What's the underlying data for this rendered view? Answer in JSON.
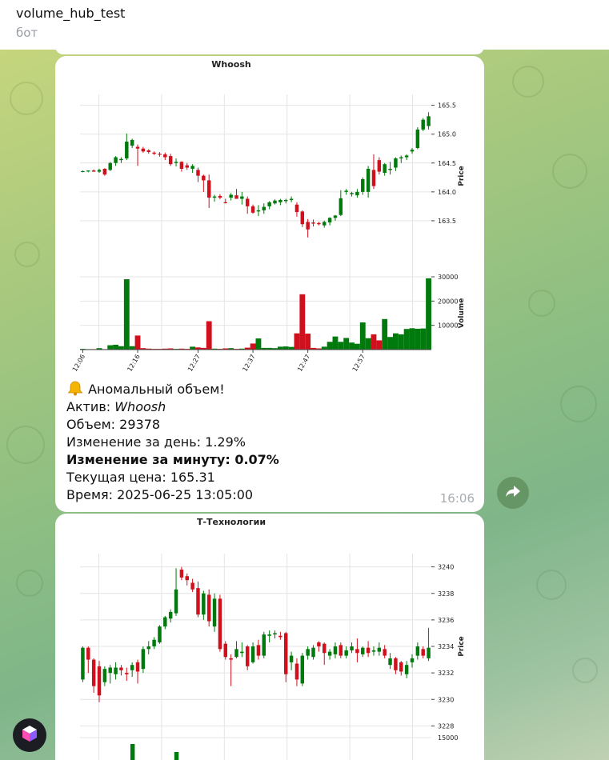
{
  "header": {
    "title": "volume_hub_test",
    "subtitle": "бот"
  },
  "message1": {
    "bell_icon": "bell-icon",
    "alert_text": "Аномальный объем!",
    "asset_label": "Актив: ",
    "asset_value": "Whoosh",
    "volume_line": "Объем: 29378",
    "day_change_line": "Изменение за день: 1.29%",
    "minute_change_line": "Изменение за минуту: 0.07%",
    "price_line": "Текущая цена: 165.31",
    "time_line": "Время: 2025-06-25 13:05:00",
    "timestamp": "16:06"
  },
  "message2": {},
  "colors": {
    "up": "#007a0c",
    "down": "#d0101d",
    "grid": "#e4e4e4"
  },
  "chart_data": [
    {
      "type": "candlestick",
      "title": "Whoosh",
      "ylabel": "Price",
      "volume_label": "Volume",
      "x_ticks": [
        "12:06",
        "12:16",
        "12:27",
        "12:37",
        "12:47",
        "12:57"
      ],
      "x_tick_index": [
        0,
        10,
        21,
        31,
        41,
        51
      ],
      "price_ticks": [
        "163.5",
        "164.0",
        "164.5",
        "165.0",
        "165.5"
      ],
      "volume_ticks": [
        "10000",
        "20000",
        "30000"
      ],
      "ylim": [
        163.0,
        165.55
      ],
      "vlim": [
        0,
        30000
      ],
      "candles": [
        [
          164.36,
          164.37,
          164.34,
          164.36,
          300
        ],
        [
          164.36,
          164.37,
          164.34,
          164.37,
          200
        ],
        [
          164.37,
          164.39,
          164.35,
          164.35,
          200
        ],
        [
          164.35,
          164.4,
          164.33,
          164.38,
          600
        ],
        [
          164.4,
          164.41,
          164.28,
          164.3,
          200
        ],
        [
          164.38,
          164.52,
          164.36,
          164.5,
          1800
        ],
        [
          164.5,
          164.62,
          164.45,
          164.6,
          2000
        ],
        [
          164.55,
          164.6,
          164.5,
          164.57,
          1400
        ],
        [
          164.58,
          165.01,
          164.55,
          164.87,
          29000
        ],
        [
          164.8,
          164.92,
          164.76,
          164.9,
          1400
        ],
        [
          164.78,
          164.82,
          164.45,
          164.75,
          5800
        ],
        [
          164.75,
          164.78,
          164.68,
          164.7,
          600
        ],
        [
          164.72,
          164.74,
          164.66,
          164.69,
          400
        ],
        [
          164.68,
          164.7,
          164.64,
          164.66,
          300
        ],
        [
          164.66,
          164.69,
          164.61,
          164.65,
          300
        ],
        [
          164.65,
          164.68,
          164.55,
          164.6,
          400
        ],
        [
          164.62,
          164.66,
          164.45,
          164.48,
          500
        ],
        [
          164.5,
          164.58,
          164.44,
          164.52,
          300
        ],
        [
          164.52,
          164.53,
          164.35,
          164.4,
          400
        ],
        [
          164.46,
          164.5,
          164.38,
          164.42,
          300
        ],
        [
          164.4,
          164.48,
          164.33,
          164.45,
          1200
        ],
        [
          164.38,
          164.42,
          164.17,
          164.28,
          900
        ],
        [
          164.28,
          164.3,
          164.0,
          164.2,
          700
        ],
        [
          164.2,
          164.3,
          163.72,
          163.9,
          11700
        ],
        [
          163.9,
          163.95,
          163.83,
          163.92,
          400
        ],
        [
          163.93,
          163.96,
          163.87,
          163.9,
          300
        ],
        [
          163.82,
          163.88,
          163.8,
          163.81,
          500
        ],
        [
          163.9,
          163.98,
          163.85,
          163.95,
          600
        ],
        [
          163.94,
          164.05,
          163.9,
          163.88,
          300
        ],
        [
          163.88,
          164.0,
          163.78,
          163.92,
          400
        ],
        [
          163.88,
          163.92,
          163.62,
          163.75,
          800
        ],
        [
          163.75,
          163.78,
          163.62,
          163.64,
          2500
        ],
        [
          163.66,
          163.77,
          163.58,
          163.68,
          4600
        ],
        [
          163.68,
          163.8,
          163.62,
          163.74,
          700
        ],
        [
          163.75,
          163.84,
          163.7,
          163.82,
          700
        ],
        [
          163.8,
          163.87,
          163.78,
          163.85,
          600
        ],
        [
          163.82,
          163.88,
          163.77,
          163.86,
          1200
        ],
        [
          163.84,
          163.88,
          163.8,
          163.86,
          1300
        ],
        [
          163.86,
          163.92,
          163.82,
          163.88,
          1100
        ],
        [
          163.78,
          163.82,
          163.57,
          163.65,
          6700
        ],
        [
          163.66,
          163.68,
          163.39,
          163.44,
          22800
        ],
        [
          163.48,
          163.53,
          163.21,
          163.35,
          6600
        ],
        [
          163.47,
          163.52,
          163.4,
          163.45,
          700
        ],
        [
          163.46,
          163.48,
          163.42,
          163.44,
          500
        ],
        [
          163.42,
          163.5,
          163.38,
          163.48,
          1200
        ],
        [
          163.47,
          163.56,
          163.42,
          163.55,
          3200
        ],
        [
          163.55,
          163.6,
          163.5,
          163.59,
          5400
        ],
        [
          163.6,
          164.03,
          163.58,
          163.89,
          3200
        ],
        [
          164.0,
          164.05,
          163.95,
          164.02,
          4800
        ],
        [
          163.96,
          164.0,
          163.92,
          163.98,
          2900
        ],
        [
          163.94,
          164.05,
          163.9,
          164.0,
          2400
        ],
        [
          164.0,
          164.25,
          163.95,
          164.22,
          11200
        ],
        [
          164.0,
          164.45,
          163.9,
          164.4,
          4700
        ],
        [
          164.38,
          164.65,
          164.05,
          164.1,
          6300
        ],
        [
          164.55,
          164.6,
          164.3,
          164.35,
          3800
        ],
        [
          164.33,
          164.5,
          164.28,
          164.48,
          12600
        ],
        [
          164.38,
          164.52,
          164.3,
          164.4,
          5200
        ],
        [
          164.42,
          164.6,
          164.36,
          164.58,
          6700
        ],
        [
          164.58,
          164.63,
          164.5,
          164.6,
          6300
        ],
        [
          164.6,
          164.65,
          164.55,
          164.63,
          8500
        ],
        [
          164.7,
          164.76,
          164.66,
          164.73,
          8800
        ],
        [
          164.76,
          165.12,
          164.74,
          165.08,
          8600
        ],
        [
          165.08,
          165.28,
          165.05,
          165.25,
          8700
        ],
        [
          165.14,
          165.38,
          165.08,
          165.31,
          29378
        ]
      ]
    },
    {
      "type": "candlestick",
      "title": "Т-Технологии",
      "ylabel": "Price",
      "price_ticks": [
        "3228",
        "3230",
        "3232",
        "3234",
        "3236",
        "3238",
        "3240"
      ],
      "volume_ticks": [
        "15000"
      ],
      "ylim": [
        3227.6,
        3240.4
      ],
      "candles": [
        [
          3231.5,
          3234.0,
          3231.3,
          3233.9
        ],
        [
          3233.9,
          3234.0,
          3232.0,
          3233.0
        ],
        [
          3233.0,
          3233.1,
          3230.5,
          3231.0
        ],
        [
          3232.5,
          3232.9,
          3229.8,
          3230.3
        ],
        [
          3231.3,
          3232.5,
          3231.0,
          3232.3
        ],
        [
          3232.0,
          3232.6,
          3231.2,
          3232.4
        ],
        [
          3231.9,
          3232.8,
          3231.5,
          3232.4
        ],
        [
          3232.4,
          3232.6,
          3231.8,
          3232.2
        ],
        [
          3232.0,
          3232.4,
          3231.4,
          3231.9
        ],
        [
          3232.2,
          3232.8,
          3231.7,
          3232.6
        ],
        [
          3232.8,
          3233.0,
          3231.2,
          3232.1
        ],
        [
          3232.3,
          3234.0,
          3232.0,
          3233.8
        ],
        [
          3233.8,
          3234.4,
          3233.4,
          3234.0
        ],
        [
          3234.0,
          3234.7,
          3233.8,
          3234.5
        ],
        [
          3234.3,
          3235.6,
          3234.2,
          3235.5
        ],
        [
          3235.5,
          3236.3,
          3235.3,
          3236.2
        ],
        [
          3236.1,
          3236.8,
          3235.8,
          3236.6
        ],
        [
          3236.5,
          3239.9,
          3236.3,
          3238.3
        ],
        [
          3239.8,
          3240.0,
          3239.0,
          3239.2
        ],
        [
          3239.3,
          3239.5,
          3238.6,
          3239.0
        ],
        [
          3238.8,
          3239.1,
          3238.1,
          3238.3
        ],
        [
          3238.4,
          3238.9,
          3236.2,
          3236.4
        ],
        [
          3236.4,
          3238.2,
          3236.0,
          3238.0
        ],
        [
          3237.9,
          3238.3,
          3235.5,
          3235.9
        ],
        [
          3235.5,
          3238.0,
          3235.1,
          3237.6
        ],
        [
          3237.6,
          3237.9,
          3233.6,
          3233.8
        ],
        [
          3234.2,
          3234.4,
          3233.0,
          3233.2
        ],
        [
          3233.1,
          3233.4,
          3231.0,
          3233.0
        ],
        [
          3233.2,
          3234.4,
          3233.1,
          3233.8
        ],
        [
          3233.5,
          3234.3,
          3233.2,
          3233.6
        ],
        [
          3234.0,
          3234.1,
          3232.2,
          3232.5
        ],
        [
          3232.8,
          3234.3,
          3232.7,
          3234.0
        ],
        [
          3234.1,
          3234.5,
          3233.0,
          3233.3
        ],
        [
          3233.3,
          3235.1,
          3233.1,
          3234.9
        ],
        [
          3234.8,
          3235.2,
          3234.3,
          3234.9
        ],
        [
          3234.9,
          3235.2,
          3234.6,
          3235.0
        ],
        [
          3234.8,
          3235.1,
          3234.5,
          3234.7
        ],
        [
          3235.0,
          3235.1,
          3231.3,
          3231.9
        ],
        [
          3232.8,
          3233.6,
          3232.2,
          3233.3
        ],
        [
          3232.7,
          3233.1,
          3231.0,
          3231.5
        ],
        [
          3231.2,
          3233.5,
          3231.0,
          3233.3
        ],
        [
          3233.3,
          3234.0,
          3233.0,
          3233.8
        ],
        [
          3233.2,
          3234.1,
          3233.0,
          3233.9
        ],
        [
          3234.3,
          3234.4,
          3233.6,
          3234.0
        ],
        [
          3234.2,
          3234.3,
          3232.6,
          3233.5
        ],
        [
          3233.3,
          3233.8,
          3233.0,
          3233.6
        ],
        [
          3233.4,
          3234.3,
          3233.1,
          3234.0
        ],
        [
          3234.1,
          3234.3,
          3233.1,
          3233.3
        ],
        [
          3233.3,
          3234.0,
          3233.1,
          3233.7
        ],
        [
          3233.7,
          3234.3,
          3233.5,
          3234.0
        ],
        [
          3233.8,
          3234.6,
          3232.8,
          3233.5
        ],
        [
          3233.4,
          3234.0,
          3233.2,
          3233.9
        ],
        [
          3233.9,
          3234.4,
          3233.2,
          3233.5
        ],
        [
          3233.6,
          3234.0,
          3233.3,
          3233.7
        ],
        [
          3233.6,
          3234.3,
          3233.3,
          3233.9
        ],
        [
          3233.8,
          3234.1,
          3233.1,
          3233.3
        ],
        [
          3232.6,
          3233.5,
          3232.3,
          3233.1
        ],
        [
          3233.1,
          3233.2,
          3231.9,
          3232.2
        ],
        [
          3232.8,
          3232.9,
          3231.8,
          3232.1
        ],
        [
          3231.9,
          3232.9,
          3231.6,
          3232.6
        ],
        [
          3232.8,
          3233.4,
          3232.4,
          3233.1
        ],
        [
          3233.3,
          3234.3,
          3233.0,
          3234.0
        ],
        [
          3233.8,
          3234.0,
          3233.1,
          3233.3
        ],
        [
          3233.1,
          3235.4,
          3232.9,
          3233.9
        ]
      ],
      "volume_partial": [
        [
          9,
          9000,
          "up"
        ],
        [
          17,
          8000,
          "up"
        ]
      ]
    }
  ]
}
